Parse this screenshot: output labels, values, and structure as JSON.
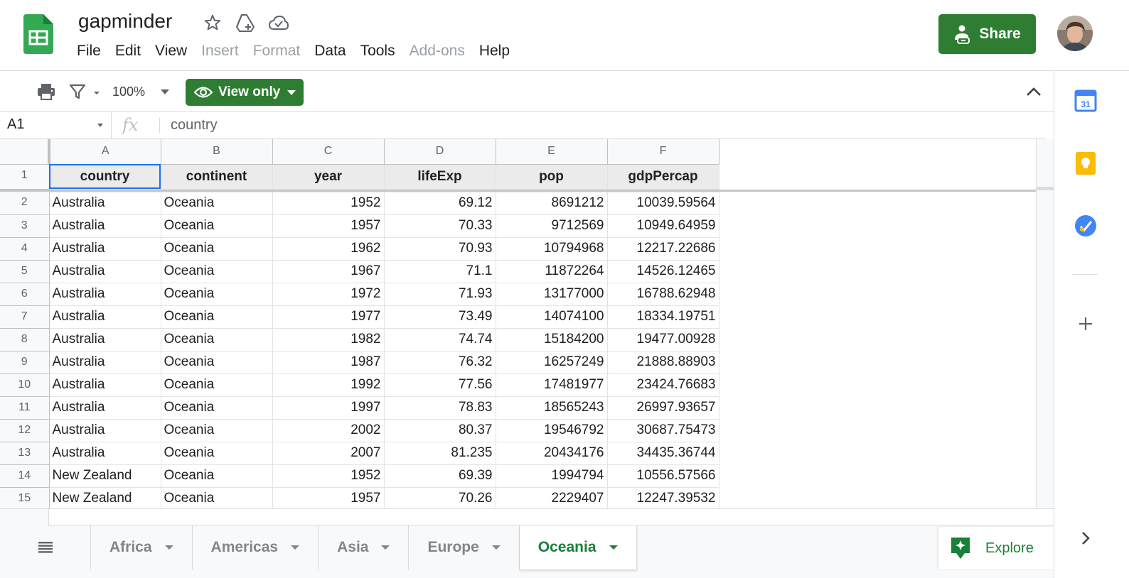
{
  "app": {
    "doc_title": "gapminder",
    "logo_icon": "sheets-logo-icon",
    "brand_color": "#34a853",
    "accent_color": "#2e7d32"
  },
  "menu": [
    "File",
    "Edit",
    "View",
    "Insert",
    "Format",
    "Data",
    "Tools",
    "Add-ons",
    "Help"
  ],
  "menu_disabled": [
    "Insert",
    "Format",
    "Add-ons"
  ],
  "header": {
    "share_label": "Share"
  },
  "toolbar": {
    "zoom": "100%",
    "view_only_label": "View only"
  },
  "formula_bar": {
    "cell_ref": "A1",
    "fx_label": "fx",
    "content": "country"
  },
  "grid": {
    "columns": [
      "A",
      "B",
      "C",
      "D",
      "E",
      "F"
    ],
    "numeric_columns": [
      2,
      3,
      4,
      5
    ],
    "header_row": {
      "row_number": "1",
      "cells": [
        "country",
        "continent",
        "year",
        "lifeExp",
        "pop",
        "gdpPercap"
      ]
    },
    "rows": [
      {
        "row_number": "2",
        "cells": [
          "Australia",
          "Oceania",
          "1952",
          "69.12",
          "8691212",
          "10039.59564"
        ]
      },
      {
        "row_number": "3",
        "cells": [
          "Australia",
          "Oceania",
          "1957",
          "70.33",
          "9712569",
          "10949.64959"
        ]
      },
      {
        "row_number": "4",
        "cells": [
          "Australia",
          "Oceania",
          "1962",
          "70.93",
          "10794968",
          "12217.22686"
        ]
      },
      {
        "row_number": "5",
        "cells": [
          "Australia",
          "Oceania",
          "1967",
          "71.1",
          "11872264",
          "14526.12465"
        ]
      },
      {
        "row_number": "6",
        "cells": [
          "Australia",
          "Oceania",
          "1972",
          "71.93",
          "13177000",
          "16788.62948"
        ]
      },
      {
        "row_number": "7",
        "cells": [
          "Australia",
          "Oceania",
          "1977",
          "73.49",
          "14074100",
          "18334.19751"
        ]
      },
      {
        "row_number": "8",
        "cells": [
          "Australia",
          "Oceania",
          "1982",
          "74.74",
          "15184200",
          "19477.00928"
        ]
      },
      {
        "row_number": "9",
        "cells": [
          "Australia",
          "Oceania",
          "1987",
          "76.32",
          "16257249",
          "21888.88903"
        ]
      },
      {
        "row_number": "10",
        "cells": [
          "Australia",
          "Oceania",
          "1992",
          "77.56",
          "17481977",
          "23424.76683"
        ]
      },
      {
        "row_number": "11",
        "cells": [
          "Australia",
          "Oceania",
          "1997",
          "78.83",
          "18565243",
          "26997.93657"
        ]
      },
      {
        "row_number": "12",
        "cells": [
          "Australia",
          "Oceania",
          "2002",
          "80.37",
          "19546792",
          "30687.75473"
        ]
      },
      {
        "row_number": "13",
        "cells": [
          "Australia",
          "Oceania",
          "2007",
          "81.235",
          "20434176",
          "34435.36744"
        ]
      },
      {
        "row_number": "14",
        "cells": [
          "New Zealand",
          "Oceania",
          "1952",
          "69.39",
          "1994794",
          "10556.57566"
        ]
      },
      {
        "row_number": "15",
        "cells": [
          "New Zealand",
          "Oceania",
          "1957",
          "70.26",
          "2229407",
          "12247.39532"
        ]
      }
    ]
  },
  "sheets": [
    {
      "label": "Africa",
      "active": false
    },
    {
      "label": "Americas",
      "active": false
    },
    {
      "label": "Asia",
      "active": false
    },
    {
      "label": "Europe",
      "active": false
    },
    {
      "label": "Oceania",
      "active": true
    }
  ],
  "explore_label": "Explore",
  "side_panel": {
    "calendar_day": "31"
  }
}
